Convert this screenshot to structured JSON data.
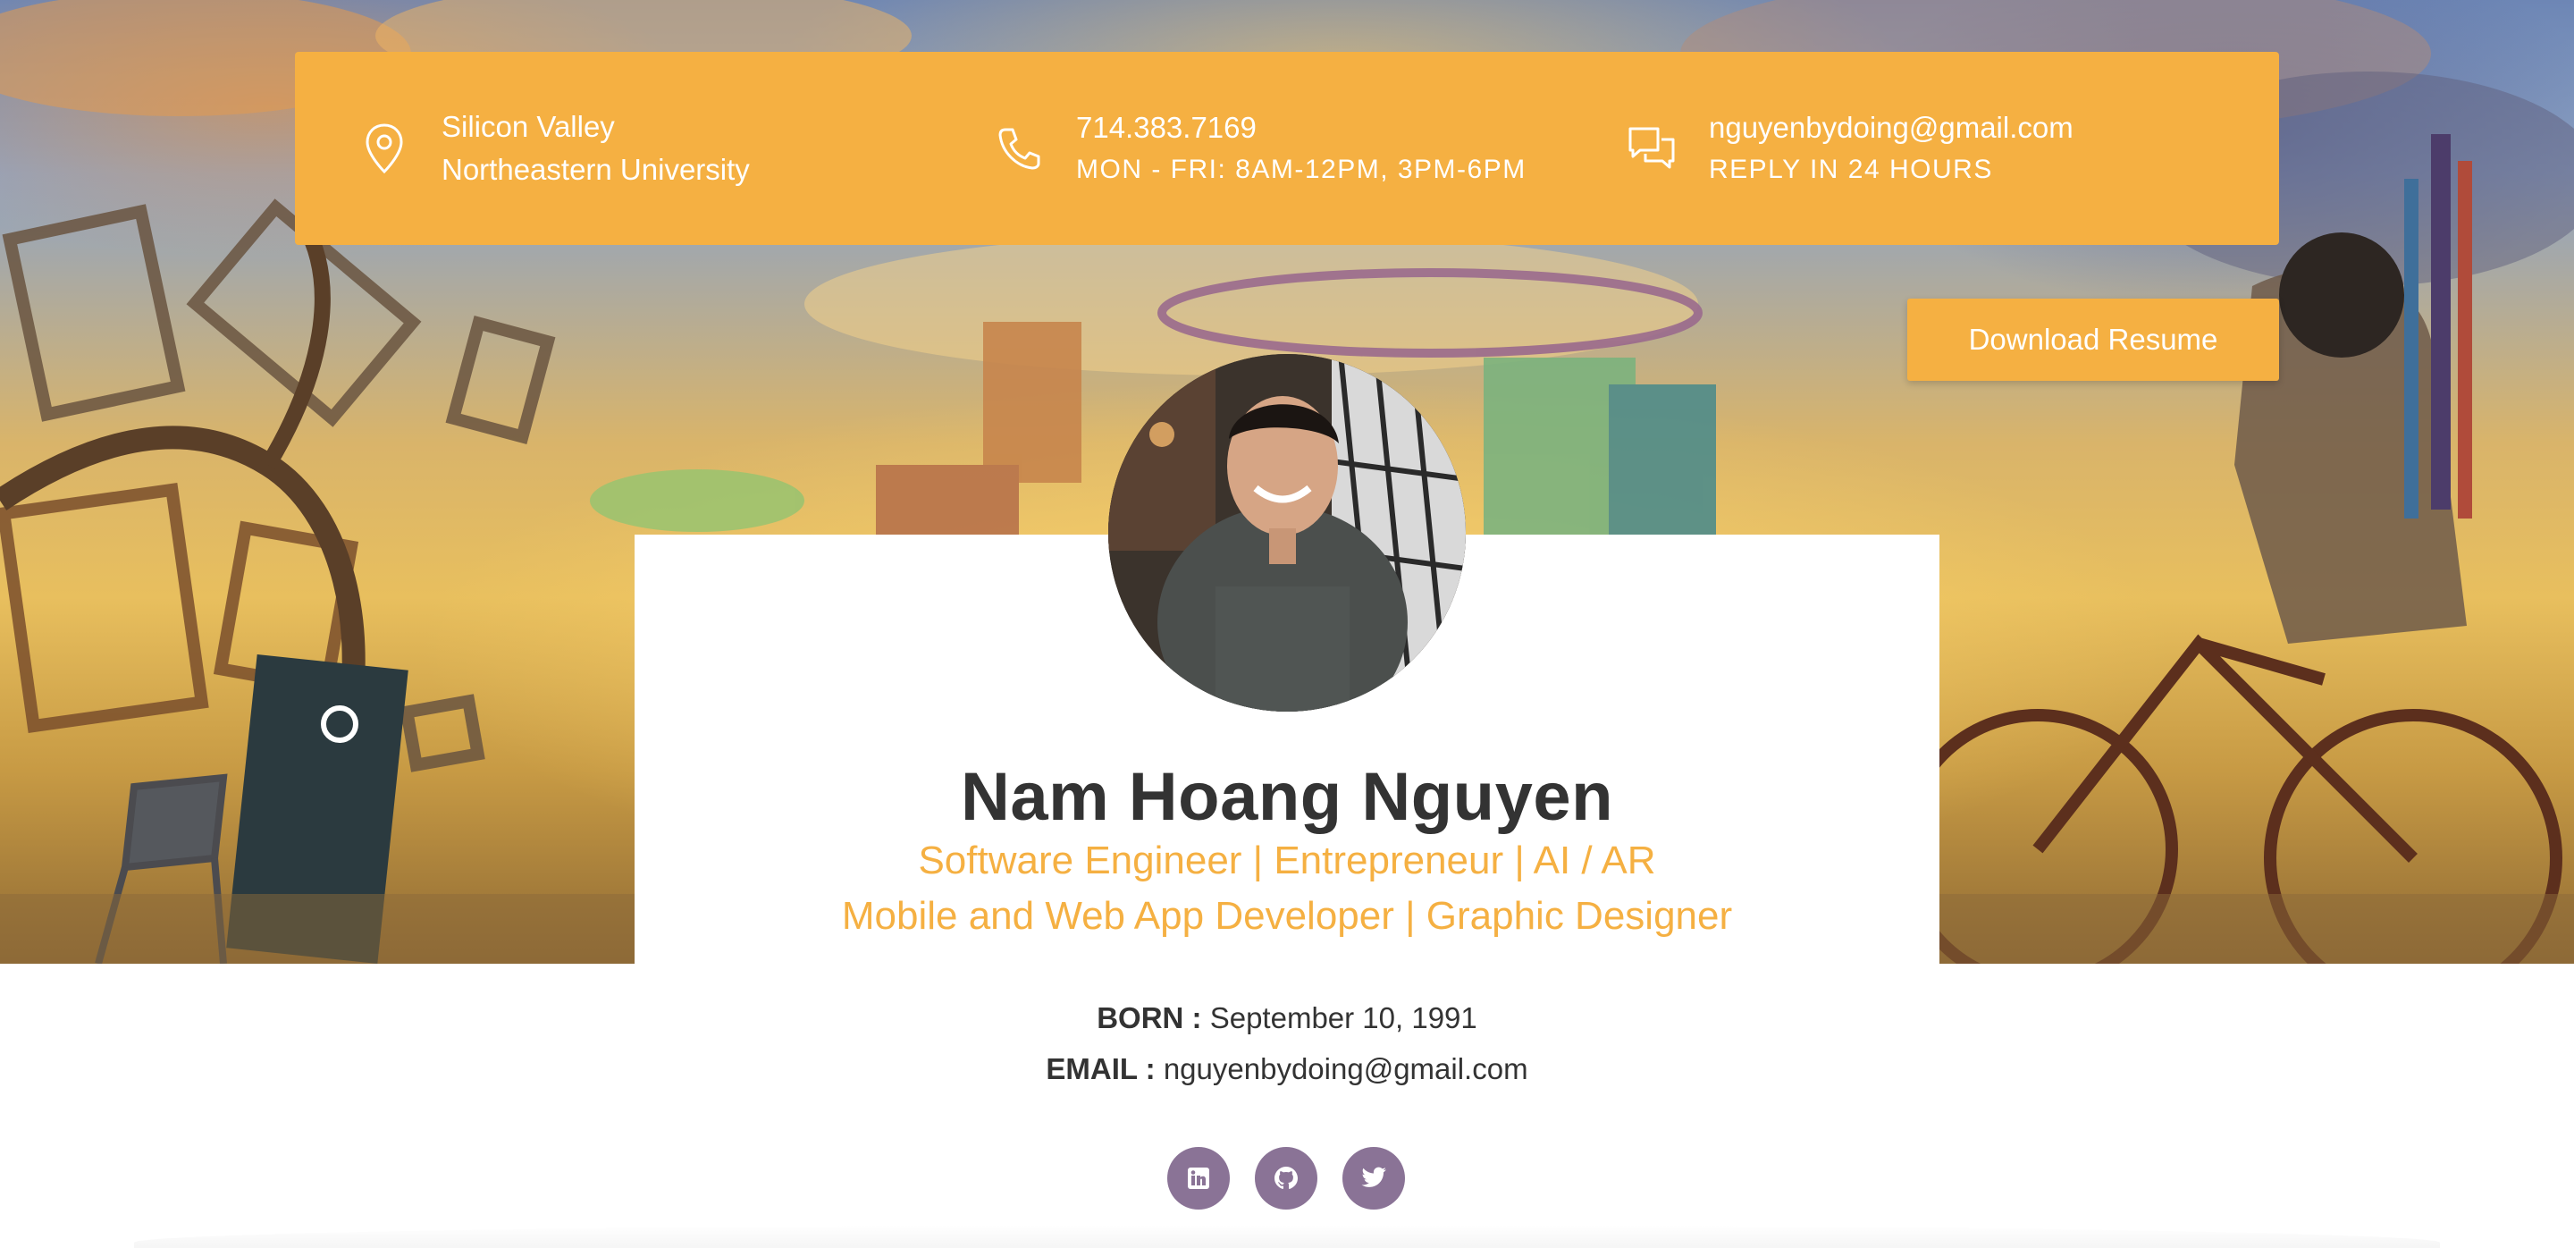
{
  "contact": {
    "location": {
      "icon": "map-pin-icon",
      "line1": "Silicon Valley",
      "line2": "Northeastern University"
    },
    "phone": {
      "icon": "phone-icon",
      "line1": "714.383.7169",
      "line2": "MON - FRI: 8AM-12PM, 3PM-6PM"
    },
    "email": {
      "icon": "chat-bubbles-icon",
      "line1": "nguyenbydoing@gmail.com",
      "line2": "REPLY IN 24 HOURS"
    }
  },
  "download_button": {
    "label": "Download Resume"
  },
  "profile": {
    "name": "Nam Hoang Nguyen",
    "subtitle_line1": "Software Engineer | Entrepreneur | AI / AR",
    "subtitle_line2": "Mobile and Web App Developer | Graphic Designer",
    "born_label": "BORN :",
    "born_value": "September 10, 1991",
    "email_label": "EMAIL :",
    "email_value": "nguyenbydoing@gmail.com"
  },
  "socials": [
    {
      "icon": "linkedin-icon"
    },
    {
      "icon": "github-icon"
    },
    {
      "icon": "twitter-icon"
    }
  ],
  "colors": {
    "accent": "#f5b042",
    "social_bg": "#8a7396",
    "text_dark": "#333333"
  }
}
